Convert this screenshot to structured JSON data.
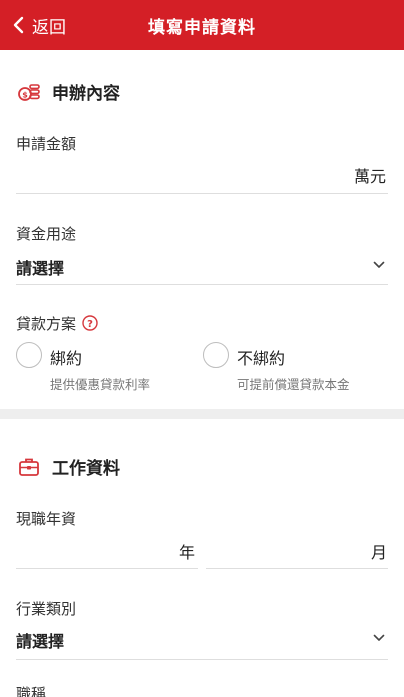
{
  "header": {
    "back_label": "返回",
    "title": "填寫申請資料"
  },
  "application": {
    "section_title": "申辦內容",
    "amount": {
      "label": "申請金額",
      "unit": "萬元"
    },
    "purpose": {
      "label": "資金用途",
      "value": "請選擇"
    },
    "plan": {
      "label": "貸款方案",
      "options": [
        {
          "label": "綁約",
          "sub": "提供優惠貸款利率"
        },
        {
          "label": "不綁約",
          "sub": "可提前償還貸款本金"
        }
      ]
    }
  },
  "job": {
    "section_title": "工作資料",
    "seniority": {
      "label": "現職年資",
      "year_unit": "年",
      "month_unit": "月"
    },
    "industry": {
      "label": "行業類別",
      "value": "請選擇"
    },
    "title_label": "職稱"
  },
  "colors": {
    "brand": "#d41f26",
    "icon": "#d6373c",
    "text": "#222222",
    "muted": "#777777",
    "divider": "#eeeeee"
  }
}
